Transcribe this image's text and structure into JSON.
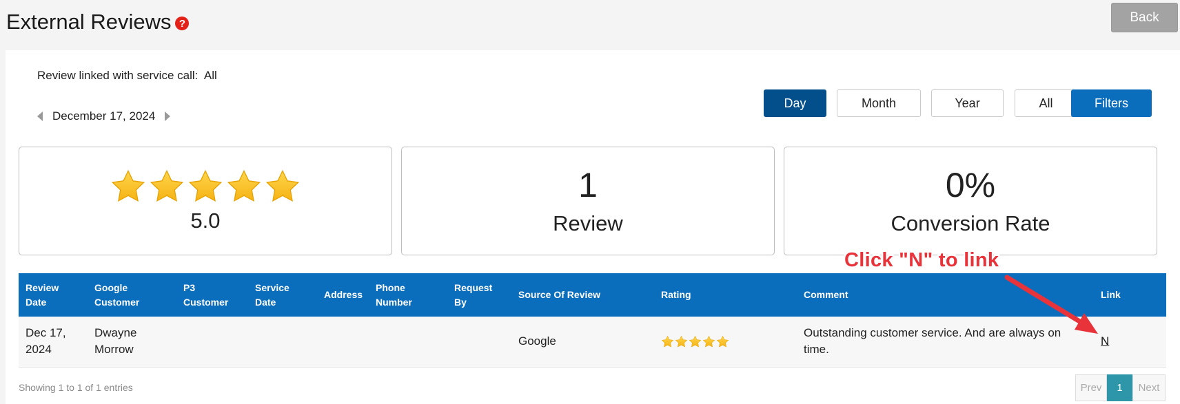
{
  "header": {
    "title": "External Reviews",
    "help_glyph": "?",
    "back_label": "Back"
  },
  "filters": {
    "linked_label": "Review linked with service call:",
    "linked_value": "All",
    "current_date": "December 17, 2024",
    "period_buttons": [
      "Day",
      "Month",
      "Year",
      "All"
    ],
    "active_period": "Day",
    "filters_label": "Filters"
  },
  "stats": {
    "rating_value": "5.0",
    "rating_stars": 5,
    "review_count": "1",
    "review_caption": "Review",
    "conversion_value": "0%",
    "conversion_caption": "Conversion Rate"
  },
  "table": {
    "headers": [
      [
        "Review",
        "Date"
      ],
      [
        "Google",
        "Customer"
      ],
      [
        "P3",
        "Customer"
      ],
      [
        "Service",
        "Date"
      ],
      [
        "Address"
      ],
      [
        "Phone",
        "Number"
      ],
      [
        "Request",
        "By"
      ],
      [
        "Source Of Review"
      ],
      [
        "Rating"
      ],
      [
        "Comment"
      ],
      [
        "Link"
      ]
    ],
    "rows": [
      {
        "review_date": "Dec 17, 2024",
        "google_customer": "Dwayne Morrow",
        "p3_customer": "",
        "service_date": "",
        "address": "",
        "phone_number": "",
        "request_by": "",
        "source": "Google",
        "rating": 5,
        "comment": "Outstanding customer service. And are always on time.",
        "link": "N"
      }
    ]
  },
  "footer": {
    "entries_info": "Showing 1 to 1 of 1 entries",
    "prev_label": "Prev",
    "current_page": "1",
    "next_label": "Next"
  },
  "annotation": {
    "text": "Click \"N\" to link"
  },
  "colors": {
    "primary": "#0a6ebd",
    "active_period": "#034f8b",
    "star": "#f5b316",
    "annotation": "#e8333a",
    "page_active": "#2d96a8"
  },
  "icons": {
    "help": "question-circle-icon",
    "star": "star-icon",
    "prev_date": "caret-left-icon",
    "next_date": "caret-right-icon",
    "annotation_arrow": "arrow-icon"
  }
}
